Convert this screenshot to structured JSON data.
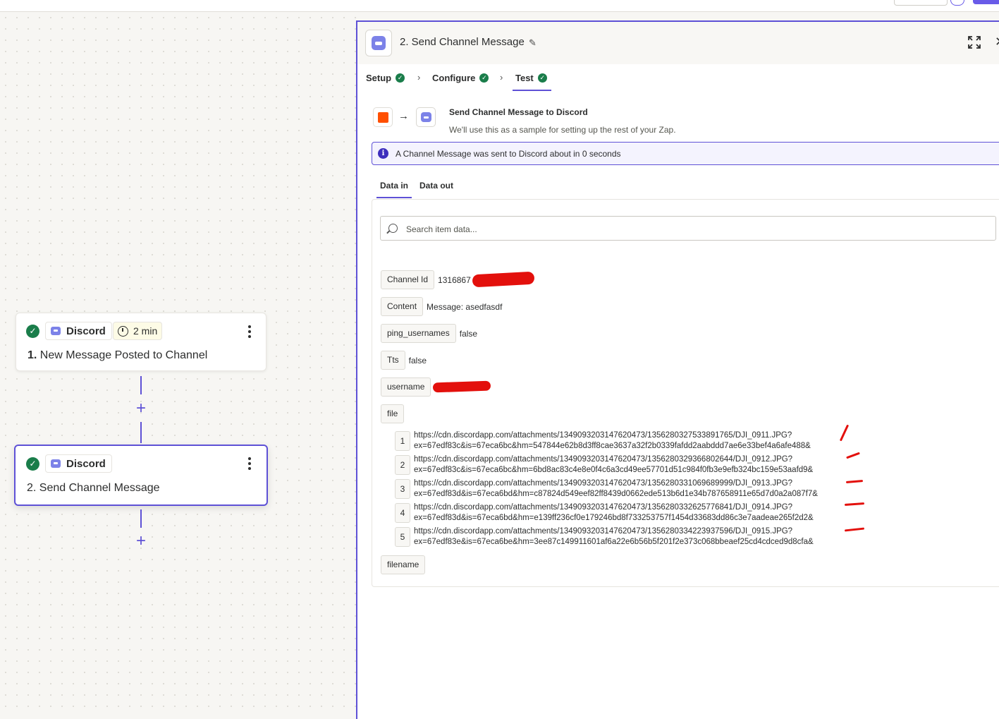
{
  "canvas": {
    "trigger_step": {
      "app_name": "Discord",
      "duration": "2 min",
      "number": "1.",
      "title": "New Message Posted to Channel"
    },
    "action_step": {
      "app_name": "Discord",
      "number": "2.",
      "title": "Send Channel Message"
    }
  },
  "panel": {
    "title": "2. Send Channel Message",
    "tabs": [
      {
        "label": "Setup"
      },
      {
        "label": "Configure"
      },
      {
        "label": "Test"
      }
    ],
    "flow": {
      "title": "Send Channel Message to Discord",
      "subtitle": "We'll use this as a sample for setting up the rest of your Zap."
    },
    "alert": "A Channel Message was sent to Discord about in 0 seconds",
    "data_tabs": {
      "data_in": "Data in",
      "data_out": "Data out"
    },
    "search_placeholder": "Search item data...",
    "fields": [
      {
        "key": "Channel Id",
        "value": "1316867"
      },
      {
        "key": "Content",
        "value": "Message: asedfasdf"
      },
      {
        "key": "ping_usernames",
        "value": "false"
      },
      {
        "key": "Tts",
        "value": "false"
      },
      {
        "key": "username",
        "value": ""
      },
      {
        "key": "file",
        "value": ""
      }
    ],
    "files": [
      {
        "index": "1",
        "line1": "https://cdn.discordapp.com/attachments/1349093203147620473/1356280327533891765/DJI_0911.JPG?",
        "line2": "ex=67edf83c&is=67eca6bc&hm=547844e62b8d3ff8cae3637a32f2b0339fafdd2aabddd7ae6e33bef4a6afe488&"
      },
      {
        "index": "2",
        "line1": "https://cdn.discordapp.com/attachments/1349093203147620473/1356280329366802644/DJI_0912.JPG?",
        "line2": "ex=67edf83c&is=67eca6bc&hm=6bd8ac83c4e8e0f4c6a3cd49ee57701d51c984f0fb3e9efb324bc159e53aafd9&"
      },
      {
        "index": "3",
        "line1": "https://cdn.discordapp.com/attachments/1349093203147620473/1356280331069689999/DJI_0913.JPG?",
        "line2": "ex=67edf83d&is=67eca6bd&hm=c87824d549eef82ff8439d0662ede513b6d1e34b787658911e65d7d0a2a087f7&"
      },
      {
        "index": "4",
        "line1": "https://cdn.discordapp.com/attachments/1349093203147620473/1356280332625776841/DJI_0914.JPG?",
        "line2": "ex=67edf83d&is=67eca6bd&hm=e139ff236cf0e179246bd8f733253757f1454d33683dd86c3e7aadeae265f2d2&"
      },
      {
        "index": "5",
        "line1": "https://cdn.discordapp.com/attachments/1349093203147620473/1356280334223937596/DJI_0915.JPG?",
        "line2": "ex=67edf83e&is=67eca6be&hm=3ee87c149911601af6a22e6b56b5f201f2e373c068bbeaef25cd4cdced9d8cfa&"
      }
    ],
    "filename_key": "filename"
  },
  "colors": {
    "accent": "#5e51d6",
    "success": "#1a7d4a",
    "zapier_orange": "#ff4f00",
    "discord": "#7c82e8",
    "redaction": "#e3100c"
  },
  "icons": [
    "check-icon",
    "clock-icon",
    "kebab-menu-icon",
    "plus-icon",
    "discord-icon",
    "pencil-icon",
    "expand-icon",
    "close-icon",
    "chevron-right-icon",
    "arrow-right-icon",
    "info-icon",
    "search-icon"
  ]
}
